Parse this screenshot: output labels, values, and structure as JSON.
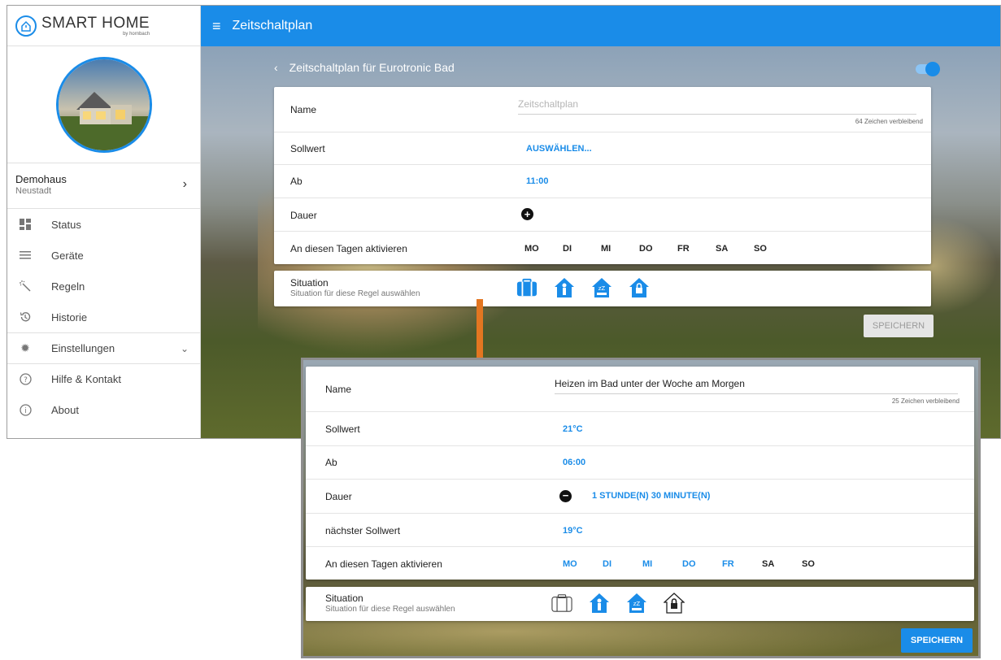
{
  "brand": {
    "name": "SMART HOME",
    "sub": "by hornbach"
  },
  "header": {
    "title": "Zeitschaltplan"
  },
  "sidebar": {
    "home_name": "Demohaus",
    "home_city": "Neustadt",
    "items": [
      {
        "label": "Status",
        "icon": "grid-icon"
      },
      {
        "label": "Geräte",
        "icon": "list-icon"
      },
      {
        "label": "Regeln",
        "icon": "magic-wand-icon"
      },
      {
        "label": "Historie",
        "icon": "history-icon"
      },
      {
        "label": "Einstellungen",
        "icon": "gear-icon"
      },
      {
        "label": "Hilfe & Kontakt",
        "icon": "help-icon"
      },
      {
        "label": "About",
        "icon": "info-icon"
      }
    ]
  },
  "top_form": {
    "title": "Zeitschaltplan für Eurotronic Bad",
    "name_label": "Name",
    "name_placeholder": "Zeitschaltplan",
    "name_remaining": "64 Zeichen verbleibend",
    "sollwert_label": "Sollwert",
    "sollwert_value": "AUSWÄHLEN...",
    "ab_label": "Ab",
    "ab_value": "11:00",
    "dauer_label": "Dauer",
    "days_label": "An diesen Tagen aktivieren",
    "days": [
      "MO",
      "DI",
      "MI",
      "DO",
      "FR",
      "SA",
      "SO"
    ],
    "situation_label": "Situation",
    "situation_sub": "Situation für diese Regel auswählen",
    "save_label": "SPEICHERN"
  },
  "bottom_form": {
    "name_label": "Name",
    "name_value": "Heizen im Bad unter der Woche am Morgen",
    "name_remaining": "25 Zeichen verbleibend",
    "sollwert_label": "Sollwert",
    "sollwert_value": "21°C",
    "ab_label": "Ab",
    "ab_value": "06:00",
    "dauer_label": "Dauer",
    "dauer_value": "1 STUNDE(N) 30 MINUTE(N)",
    "next_label": "nächster Sollwert",
    "next_value": "19°C",
    "days_label": "An diesen Tagen aktivieren",
    "days": [
      "MO",
      "DI",
      "MI",
      "DO",
      "FR",
      "SA",
      "SO"
    ],
    "situation_label": "Situation",
    "situation_sub": "Situation für diese Regel auswählen",
    "save_label": "SPEICHERN"
  },
  "colors": {
    "accent": "#1a8ce8",
    "arrow": "#e37621"
  }
}
